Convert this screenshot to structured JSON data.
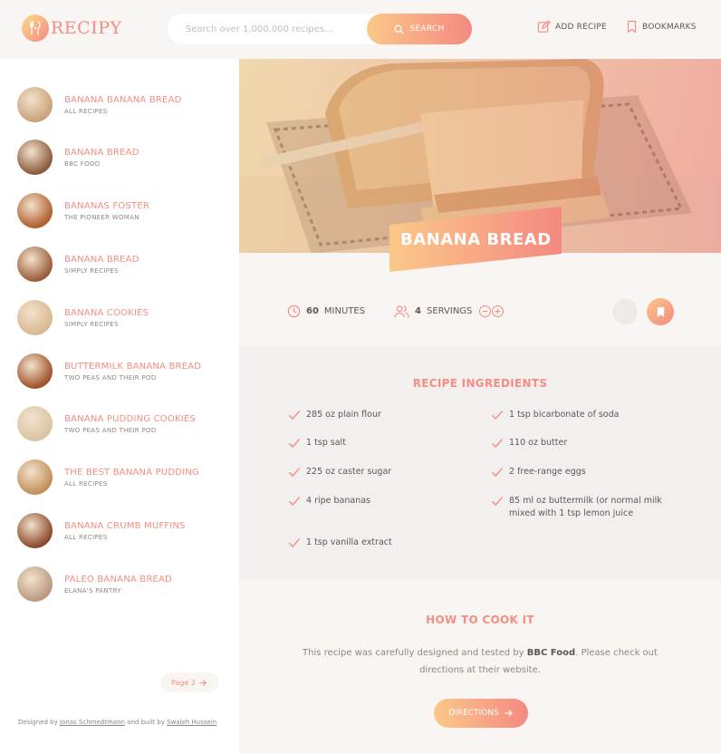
{
  "header": {
    "logo_text": "RECIPY",
    "search_placeholder": "Search over 1,000,000 recipes...",
    "search_label": "SEARCH",
    "add_recipe_label": "ADD RECIPE",
    "bookmarks_label": "BOOKMARKS"
  },
  "sidebar": {
    "results": [
      {
        "title": "BANANA BANANA BREAD",
        "publisher": "ALL RECIPES",
        "color": "#c9a27a"
      },
      {
        "title": "BANANA BREAD",
        "publisher": "BBC FOOD",
        "color": "#8a5a3c"
      },
      {
        "title": "BANANAS FOSTER",
        "publisher": "THE PIONEER WOMAN",
        "color": "#b0602e"
      },
      {
        "title": "BANANA BREAD",
        "publisher": "SIMPLY RECIPES",
        "color": "#9a5d3a"
      },
      {
        "title": "BANANA COOKIES",
        "publisher": "SIMPLY RECIPES",
        "color": "#d8b890"
      },
      {
        "title": "BUTTERMILK BANANA BREAD",
        "publisher": "TWO PEAS AND THEIR POD",
        "color": "#a0522d"
      },
      {
        "title": "BANANA PUDDING COOKIES",
        "publisher": "TWO PEAS AND THEIR POD",
        "color": "#d9c3a3"
      },
      {
        "title": "THE BEST BANANA PUDDING",
        "publisher": "ALL RECIPES",
        "color": "#c28f5a"
      },
      {
        "title": "BANANA CRUMB MUFFINS",
        "publisher": "ALL RECIPES",
        "color": "#8b4a2b"
      },
      {
        "title": "PALEO BANANA BREAD",
        "publisher": "ELANA'S PANTRY",
        "color": "#b89a80"
      }
    ],
    "page_label": "Page 2",
    "credit_prefix": "Designed by",
    "credit_designer": "Jonas Schmedtmann",
    "credit_middle": "and built by",
    "credit_builder": "Swaleh Hussein"
  },
  "recipe": {
    "title": "BANANA BREAD",
    "minutes": "60",
    "minutes_label": "MINUTES",
    "servings": "4",
    "servings_label": "SERVINGS"
  },
  "ingredients": {
    "heading": "RECIPE INGREDIENTS",
    "items": [
      "285 oz plain flour",
      "1 tsp bicarbonate of soda",
      "1 tsp salt",
      "110 oz butter",
      "225 oz caster sugar",
      "2 free-range eggs",
      "4 ripe bananas",
      "85 ml oz buttermilk (or normal milk mixed with 1 tsp lemon juice",
      "1 tsp vanilla extract"
    ]
  },
  "cook": {
    "heading": "HOW TO COOK IT",
    "text_before": "This recipe was carefully designed and tested by",
    "publisher": "BBC Food",
    "text_after": ". Please check out directions at their website.",
    "button_label": "DIRECTIONS"
  },
  "colors": {
    "accent": "#f38e82",
    "gradient_start": "#fbdb89",
    "gradient_end": "#f48982",
    "text": "#615551",
    "muted": "#918581"
  },
  "icons": [
    "search-icon",
    "edit-icon",
    "bookmark-icon",
    "clock-icon",
    "users-icon",
    "minus-circle-icon",
    "plus-circle-icon",
    "check-icon",
    "arrow-right-icon",
    "logo-cutlery-icon"
  ]
}
